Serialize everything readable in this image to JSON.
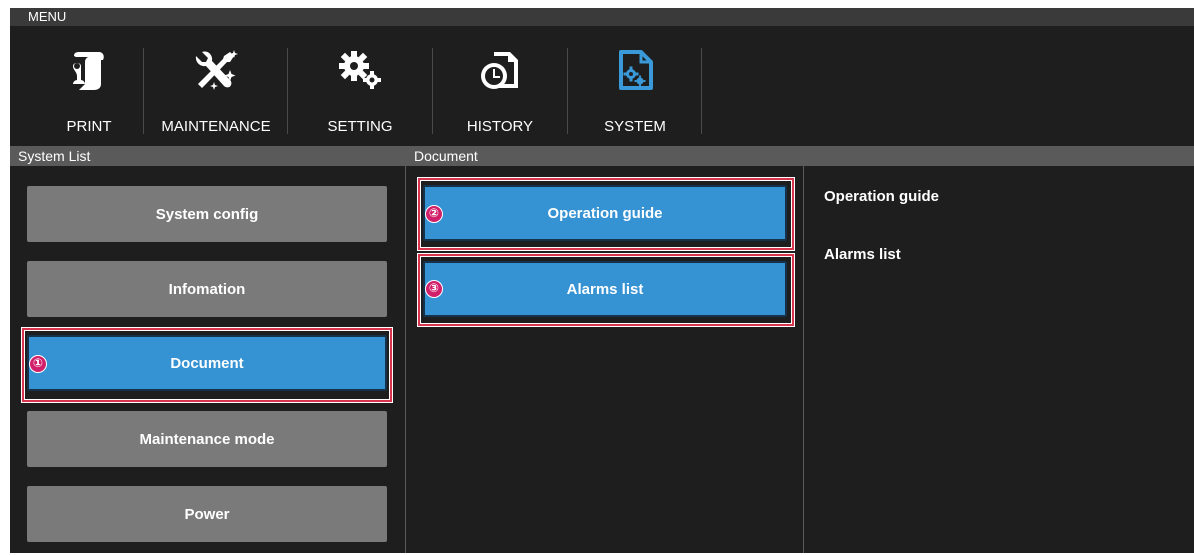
{
  "menu": {
    "title": "MENU"
  },
  "toolbar": [
    {
      "label": "PRINT",
      "icon": "print-icon"
    },
    {
      "label": "MAINTENANCE",
      "icon": "tools-icon"
    },
    {
      "label": "SETTING",
      "icon": "gears-icon"
    },
    {
      "label": "HISTORY",
      "icon": "history-icon"
    },
    {
      "label": "SYSTEM",
      "icon": "system-icon",
      "active": true
    }
  ],
  "system_list": {
    "header": "System List",
    "items": [
      "System config",
      "Infomation",
      "Document",
      "Maintenance mode",
      "Power"
    ],
    "selected": "Document"
  },
  "document": {
    "header": "Document",
    "buttons": [
      "Operation guide",
      "Alarms list"
    ]
  },
  "detail": {
    "items": [
      "Operation guide",
      "Alarms list"
    ]
  },
  "callouts": [
    "①",
    "②",
    "③"
  ],
  "colors": {
    "accent": "#3592d3",
    "system_icon": "#3a9ad9",
    "button_gray": "#7a7a7a",
    "highlight": "#d9344e",
    "badge": "#d21f6a"
  }
}
